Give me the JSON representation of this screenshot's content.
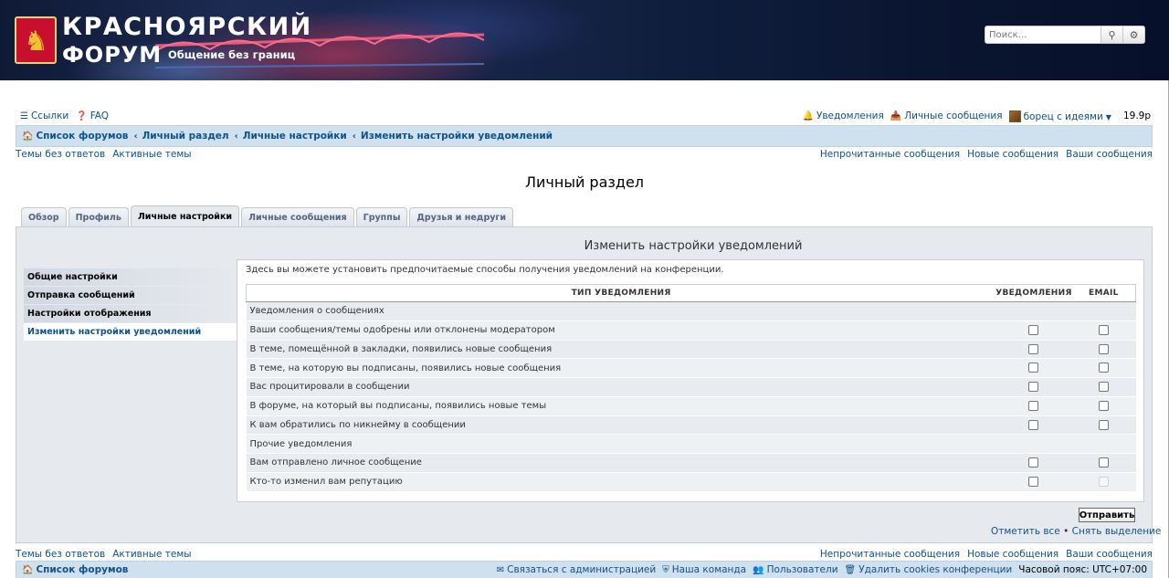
{
  "header": {
    "site_title_line1": "КРАСНОЯРСКИЙ",
    "site_title_line2": "ФОРУМ",
    "tagline": "Общение без границ",
    "search_placeholder": "Поиск…"
  },
  "topnav": {
    "links_label": "Ссылки",
    "faq_label": "FAQ",
    "notifications_label": "Уведомления",
    "pm_label": "Личные сообщения",
    "username": "борец с идеями",
    "balance": "19.9р"
  },
  "breadcrumbs": [
    "Список форумов",
    "Личный раздел",
    "Личные настройки",
    "Изменить настройки уведомлений"
  ],
  "quicklinks": {
    "left": [
      "Темы без ответов",
      "Активные темы"
    ],
    "right": [
      "Непрочитанные сообщения",
      "Новые сообщения",
      "Ваши сообщения"
    ]
  },
  "page_title": "Личный раздел",
  "tabs": [
    {
      "label": "Обзор",
      "active": false
    },
    {
      "label": "Профиль",
      "active": false
    },
    {
      "label": "Личные настройки",
      "active": true
    },
    {
      "label": "Личные сообщения",
      "active": false
    },
    {
      "label": "Группы",
      "active": false
    },
    {
      "label": "Друзья и недруги",
      "active": false
    }
  ],
  "side_menu": [
    {
      "label": "Общие настройки",
      "active": false
    },
    {
      "label": "Отправка сообщений",
      "active": false
    },
    {
      "label": "Настройки отображения",
      "active": false
    },
    {
      "label": "Изменить настройки уведомлений",
      "active": true
    }
  ],
  "section_title": "Изменить настройки уведомлений",
  "intro": "Здесь вы можете установить предпочитаемые способы получения уведомлений на конференции.",
  "table": {
    "headers": [
      "ТИП УВЕДОМЛЕНИЯ",
      "УВЕДОМЛЕНИЯ",
      "EMAIL"
    ],
    "rows": [
      {
        "label": "Уведомления о сообщениях",
        "group": true
      },
      {
        "label": "Ваши сообщения/темы одобрены или отклонены модератором",
        "notify": false,
        "email": false
      },
      {
        "label": "В теме, помещённой в закладки, появились новые сообщения",
        "notify": false,
        "email": false
      },
      {
        "label": "В теме, на которую вы подписаны, появились новые сообщения",
        "notify": false,
        "email": false
      },
      {
        "label": "Вас процитировали в сообщении",
        "notify": false,
        "email": false
      },
      {
        "label": "В форуме, на который вы подписаны, появились новые темы",
        "notify": false,
        "email": false
      },
      {
        "label": "К вам обратились по никнейму в сообщении",
        "notify": false,
        "email": false
      },
      {
        "label": "Прочие уведомления",
        "group": true
      },
      {
        "label": "Вам отправлено личное сообщение",
        "notify": false,
        "email": false
      },
      {
        "label": "Кто-то изменил вам репутацию",
        "notify": false,
        "email": false,
        "email_disabled": true
      }
    ]
  },
  "submit_label": "Отправить",
  "mark_all": "Отметить все",
  "mark_sep": "•",
  "unmark_all": "Снять выделение",
  "footer": {
    "home": "Список форумов",
    "contact": "Связаться с администрацией",
    "team": "Наша команда",
    "members": "Пользователи",
    "delete_cookies": "Удалить cookies конференции",
    "timezone_label": "Часовой пояс:",
    "timezone_value": "UTC+07:00"
  },
  "colors": {
    "link": "#105289",
    "breadcrumb_bg": "#cfe0ee",
    "panel_bg": "#e6e9ed"
  }
}
